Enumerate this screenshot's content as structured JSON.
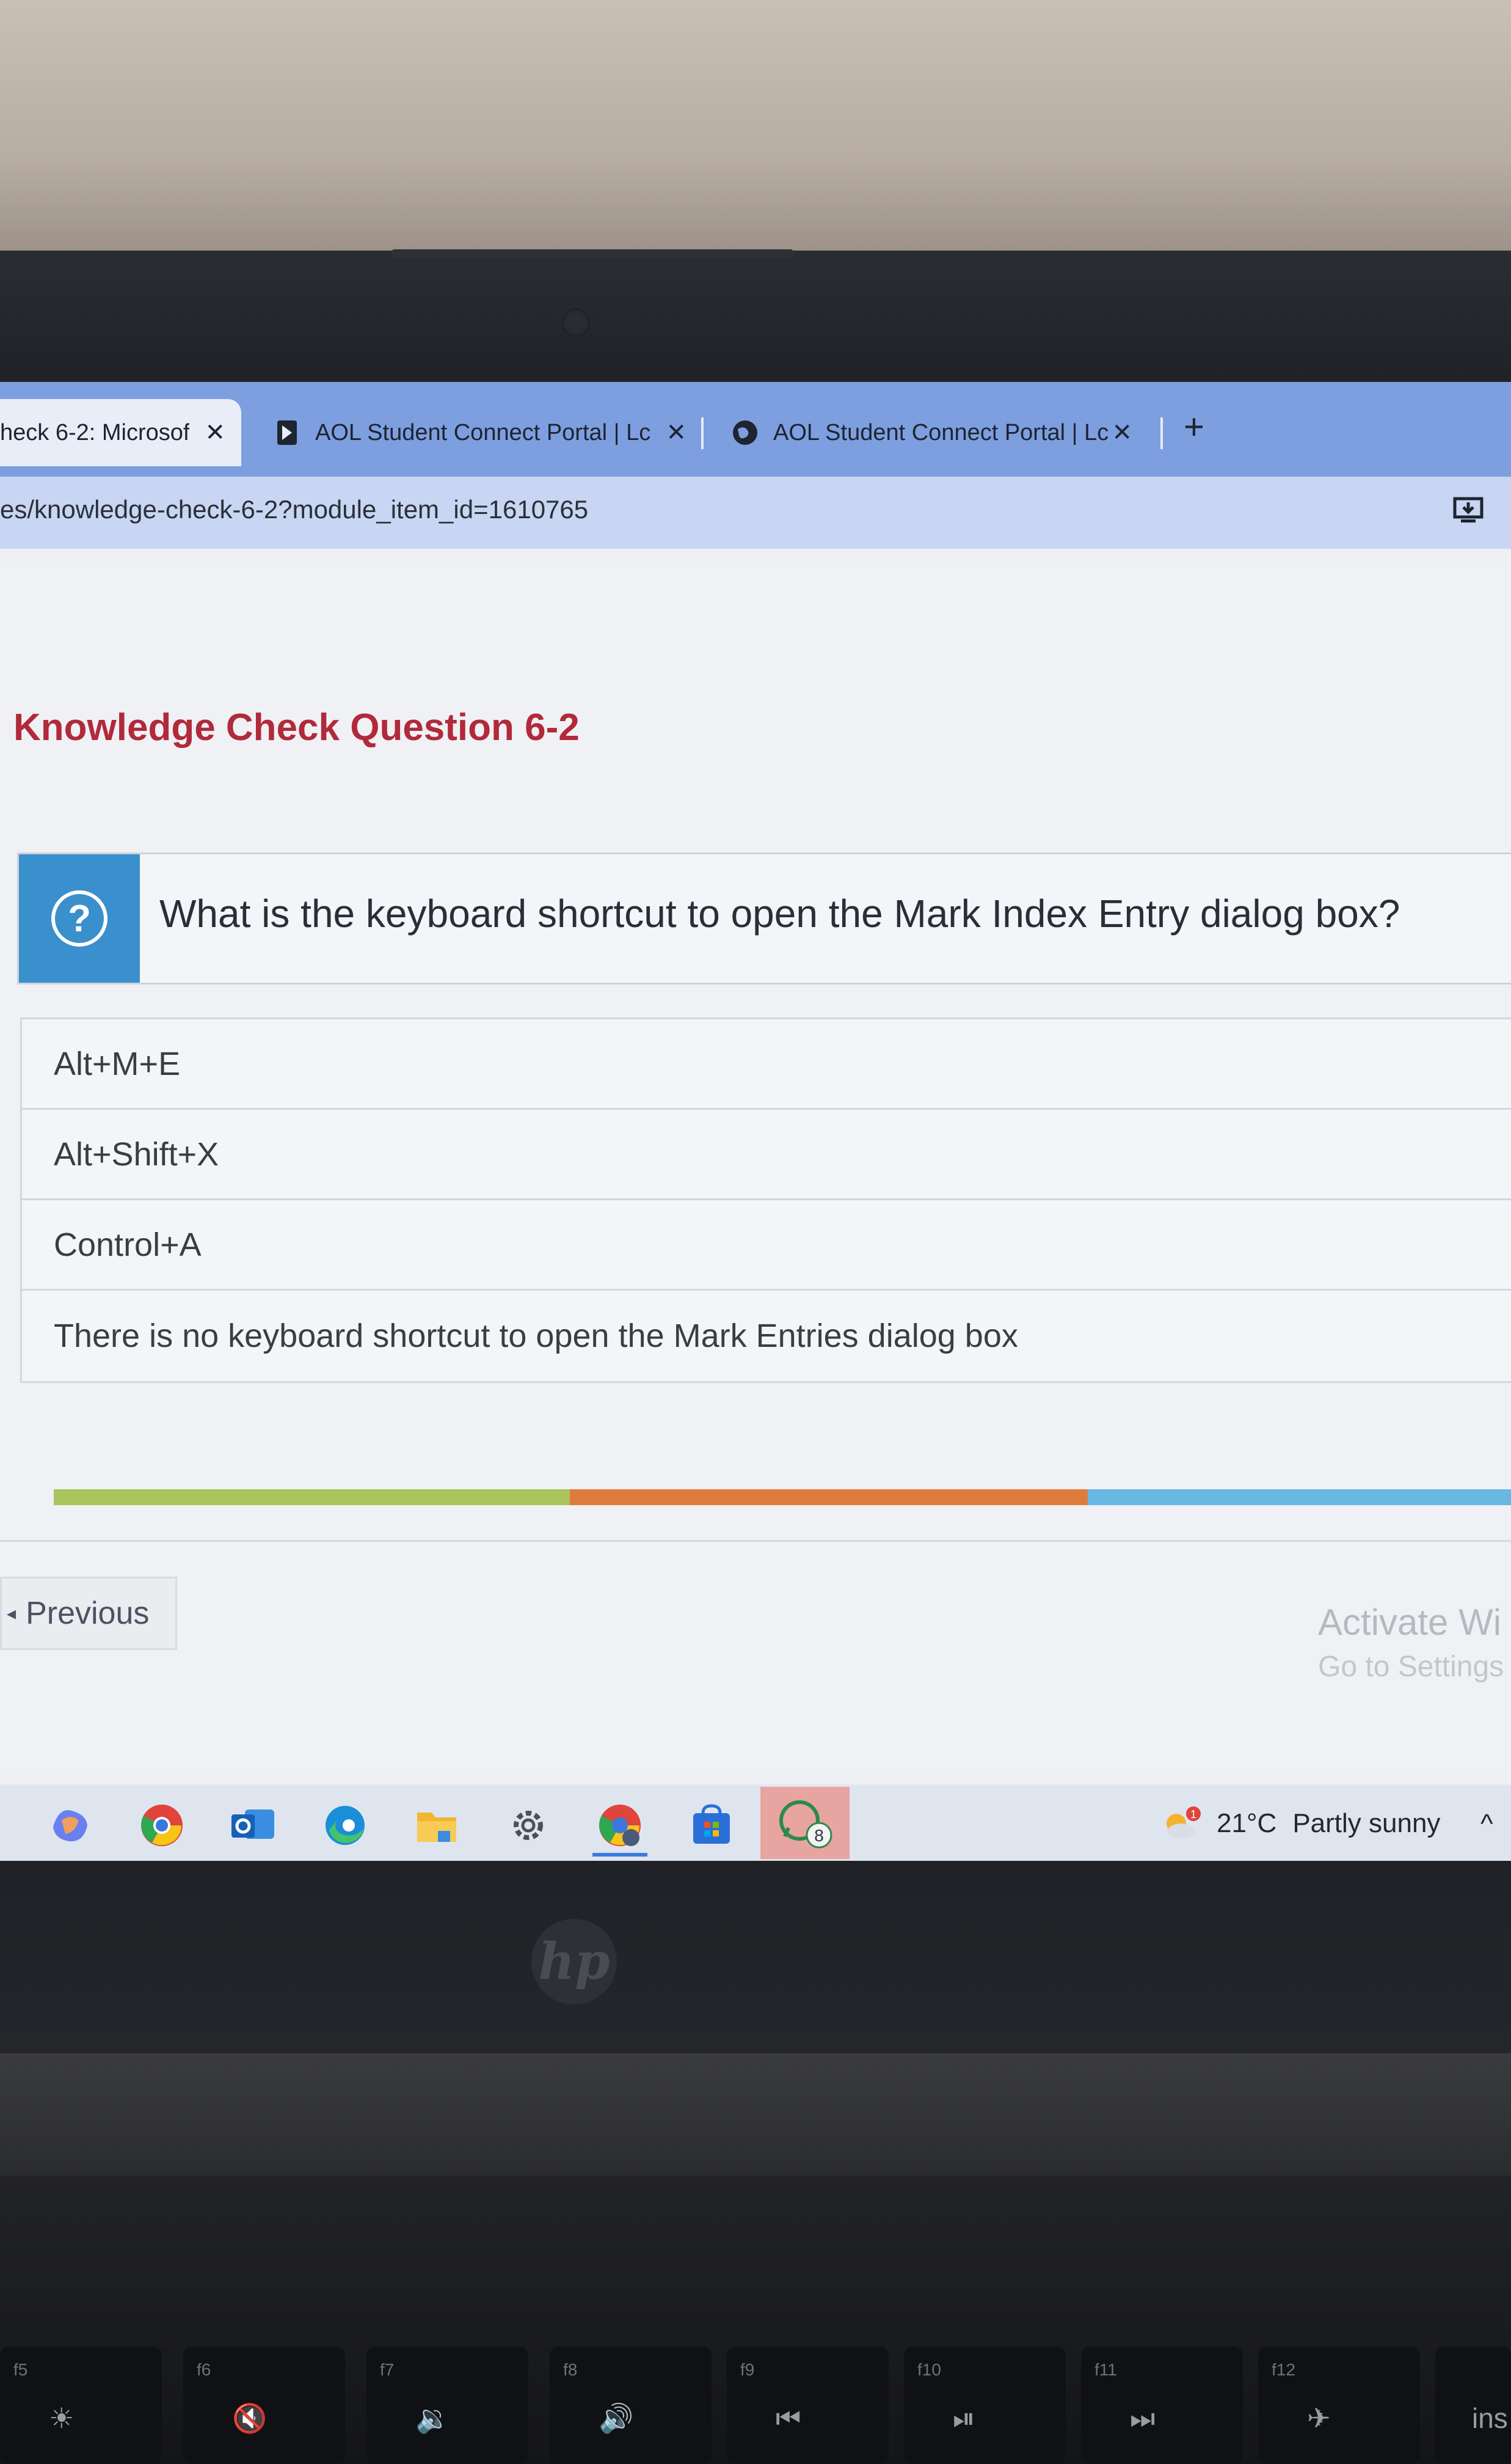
{
  "browser": {
    "tabs": [
      {
        "title": "heck 6-2: Microsof",
        "close": "✕",
        "active": true
      },
      {
        "title": "AOL Student Connect Portal | Lc",
        "close": "✕",
        "active": false,
        "icon": "bookmark-icon"
      },
      {
        "title": "AOL Student Connect Portal | Lc",
        "close": "✕",
        "active": false,
        "icon": "globe-icon"
      }
    ],
    "new_tab": "+",
    "url": "es/knowledge-check-6-2?module_item_id=1610765"
  },
  "page": {
    "heading": "Knowledge Check Question 6-2",
    "question_icon": "?",
    "question": "What is the keyboard shortcut to open the Mark Index Entry dialog box?",
    "answers": [
      "Alt+M+E",
      "Alt+Shift+X",
      "Control+A",
      "There is no keyboard shortcut to open the Mark Entries dialog box"
    ],
    "progress_colors": [
      "#a9c45d",
      "#e07b3e",
      "#67b9e3"
    ],
    "previous_label": "Previous",
    "previous_arrow": "◂"
  },
  "windows_watermark": {
    "line1": "Activate Wi",
    "line2": "Go to Settings"
  },
  "taskbar": {
    "apps": [
      "copilot-icon",
      "chrome-icon",
      "outlook-icon",
      "edge-icon",
      "file-explorer-icon",
      "settings-icon",
      "chrome-profile-icon",
      "store-icon",
      "whatsapp-icon"
    ],
    "whatsapp_badge": "8",
    "weather_alert": "1",
    "temperature": "21°C",
    "weather": "Partly sunny",
    "chevron": "^"
  },
  "device": {
    "logo": "hp",
    "keys": [
      {
        "fn": "f5",
        "sym": "☀"
      },
      {
        "fn": "f6",
        "sym": "🔇"
      },
      {
        "fn": "f7",
        "sym": "🔉"
      },
      {
        "fn": "f8",
        "sym": "🔊"
      },
      {
        "fn": "f9",
        "sym": "⏮"
      },
      {
        "fn": "f10",
        "sym": "⏯"
      },
      {
        "fn": "f11",
        "sym": "⏭"
      },
      {
        "fn": "f12",
        "sym": "✈"
      },
      {
        "fn": "",
        "sym": "ins"
      }
    ]
  }
}
